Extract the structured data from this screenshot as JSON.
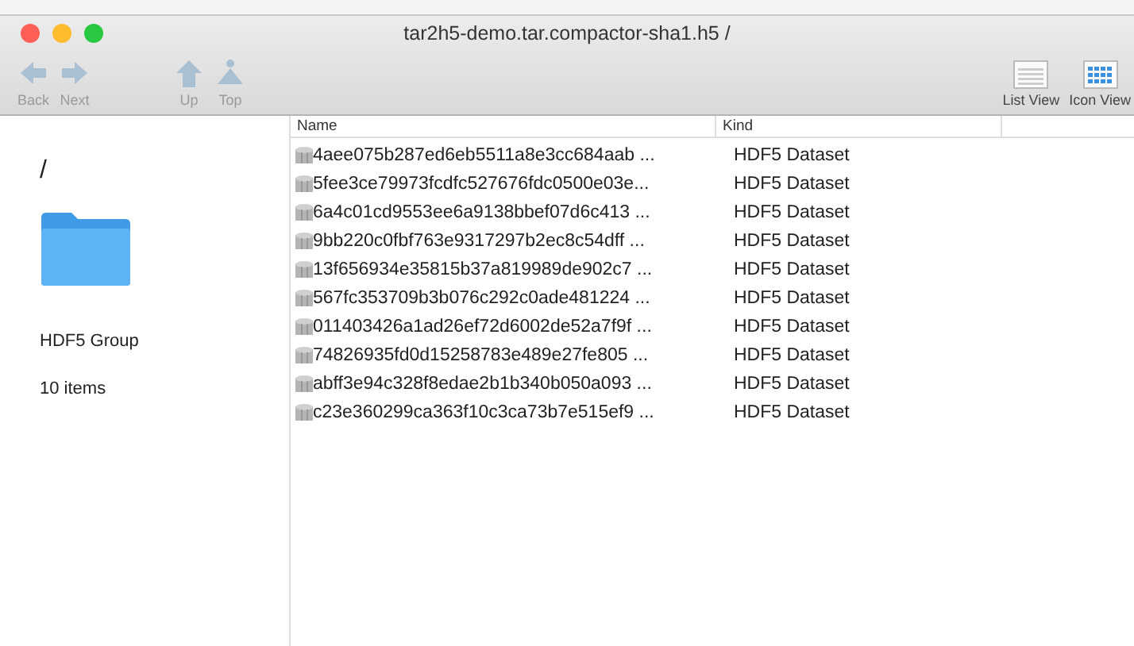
{
  "window": {
    "title": "tar2h5-demo.tar.compactor-sha1.h5 /"
  },
  "toolbar": {
    "nav": [
      {
        "label": "Back",
        "kind": "back",
        "disabled": true
      },
      {
        "label": "Next",
        "kind": "next",
        "disabled": true
      },
      {
        "label": "Up",
        "kind": "up",
        "disabled": true
      },
      {
        "label": "Top",
        "kind": "top",
        "disabled": true
      }
    ],
    "views": [
      {
        "label": "List View",
        "kind": "list"
      },
      {
        "label": "Icon View",
        "kind": "icon"
      }
    ]
  },
  "sidebar": {
    "path": "/",
    "type": "HDF5 Group",
    "count": "10 items"
  },
  "table": {
    "columns": [
      "Name",
      "Kind"
    ],
    "rows": [
      {
        "name": "4aee075b287ed6eb5511a8e3cc684aab ...",
        "kind": "HDF5 Dataset"
      },
      {
        "name": "5fee3ce79973fcdfc527676fdc0500e03e...",
        "kind": "HDF5 Dataset"
      },
      {
        "name": "6a4c01cd9553ee6a9138bbef07d6c413 ...",
        "kind": "HDF5 Dataset"
      },
      {
        "name": "9bb220c0fbf763e9317297b2ec8c54dff ...",
        "kind": "HDF5 Dataset"
      },
      {
        "name": "13f656934e35815b37a819989de902c7 ...",
        "kind": "HDF5 Dataset"
      },
      {
        "name": "567fc353709b3b076c292c0ade481224 ...",
        "kind": "HDF5 Dataset"
      },
      {
        "name": "011403426a1ad26ef72d6002de52a7f9f ...",
        "kind": "HDF5 Dataset"
      },
      {
        "name": "74826935fd0d15258783e489e27fe805 ...",
        "kind": "HDF5 Dataset"
      },
      {
        "name": "abff3e94c328f8edae2b1b340b050a093 ...",
        "kind": "HDF5 Dataset"
      },
      {
        "name": "c23e360299ca363f10c3ca73b7e515ef9 ...",
        "kind": "HDF5 Dataset"
      }
    ]
  }
}
